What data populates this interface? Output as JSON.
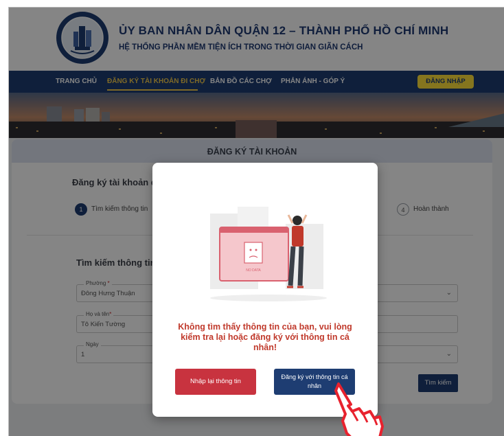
{
  "header": {
    "title": "ỦY BAN NHÂN DÂN QUẬN 12 – THÀNH PHỐ HỒ CHÍ MINH",
    "subtitle": "HỆ THỐNG PHẦN MỀM TIỆN ÍCH TRONG THỜI GIAN GIÃN CÁCH"
  },
  "nav": {
    "items": [
      {
        "label": "TRANG CHỦ"
      },
      {
        "label": "ĐĂNG KÝ TÀI KHOẢN ĐI CHỢ"
      },
      {
        "label": "BẢN ĐỒ CÁC CHỢ"
      },
      {
        "label": "PHẢN ÁNH - GÓP Ý"
      }
    ],
    "login_label": "ĐĂNG NHẬP"
  },
  "card": {
    "title": "ĐĂNG KÝ TÀI KHOẢN",
    "section_title": "Đăng ký tài khoản đ",
    "steps": [
      {
        "num": "1",
        "label": "Tìm kiếm thông tin"
      },
      {
        "num": "4",
        "label": "Hoàn thành"
      }
    ],
    "search_title": "Tìm kiếm thông tin",
    "fields": {
      "ward": {
        "label": "Phường",
        "value": "Đông Hưng Thuận"
      },
      "name": {
        "label": "Họ và tên",
        "value": "Tô Kiến Tường"
      },
      "day": {
        "label": "Ngày",
        "value": "1"
      }
    },
    "search_button": "Tìm kiếm"
  },
  "modal": {
    "illustration_text": "NO DATA",
    "message": "Không tìm thấy thông tin của bạn, vui lòng kiểm tra lại hoặc đăng ký với thông tin cá nhân!",
    "retry_label": "Nhập lại thông tin",
    "register_label": "Đăng ký với thông tin cá nhân"
  },
  "colors": {
    "navy": "#1e3d72",
    "accent_yellow": "#ffe03a",
    "error_red": "#c0392b",
    "retry_red": "#c8333f"
  },
  "icons": [
    "district-logo-icon",
    "chevron-down-icon",
    "pointing-hand-icon",
    "no-data-illustration-icon"
  ]
}
